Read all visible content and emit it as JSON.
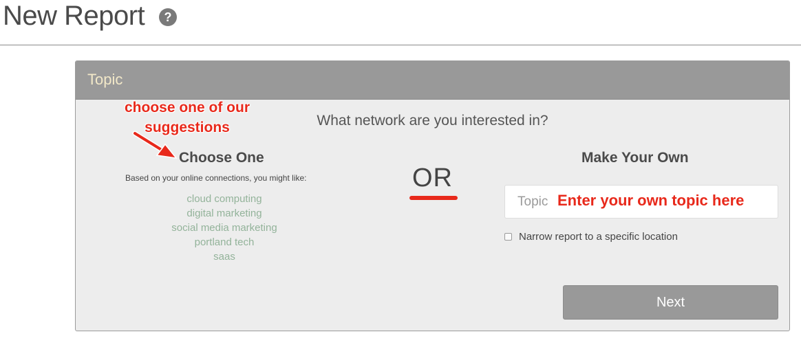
{
  "page": {
    "title": "New Report",
    "help_icon": "question-circle-icon"
  },
  "panel": {
    "title": "Topic",
    "question": "What network are you interested in?",
    "left": {
      "heading": "Choose One",
      "subtext": "Based on your online connections, you might like:",
      "suggestions": [
        "cloud computing",
        "digital marketing",
        "social media marketing",
        "portland tech",
        "saas"
      ]
    },
    "divider_text": "OR",
    "right": {
      "heading": "Make Your Own",
      "topic_placeholder": "Topic",
      "topic_value": "",
      "narrow_label": "Narrow report to a specific location",
      "narrow_checked": false,
      "next_label": "Next"
    }
  },
  "annotations": {
    "suggest": "choose one of our suggestions",
    "topic": "Enter your own topic here",
    "arrow_icon": "red-arrow-icon"
  },
  "colors": {
    "accent_red": "#e8291b",
    "header_bg": "#999999",
    "panel_bg": "#ededed",
    "suggestion_green": "#93b39a",
    "title_cream": "#f2e8c8"
  }
}
